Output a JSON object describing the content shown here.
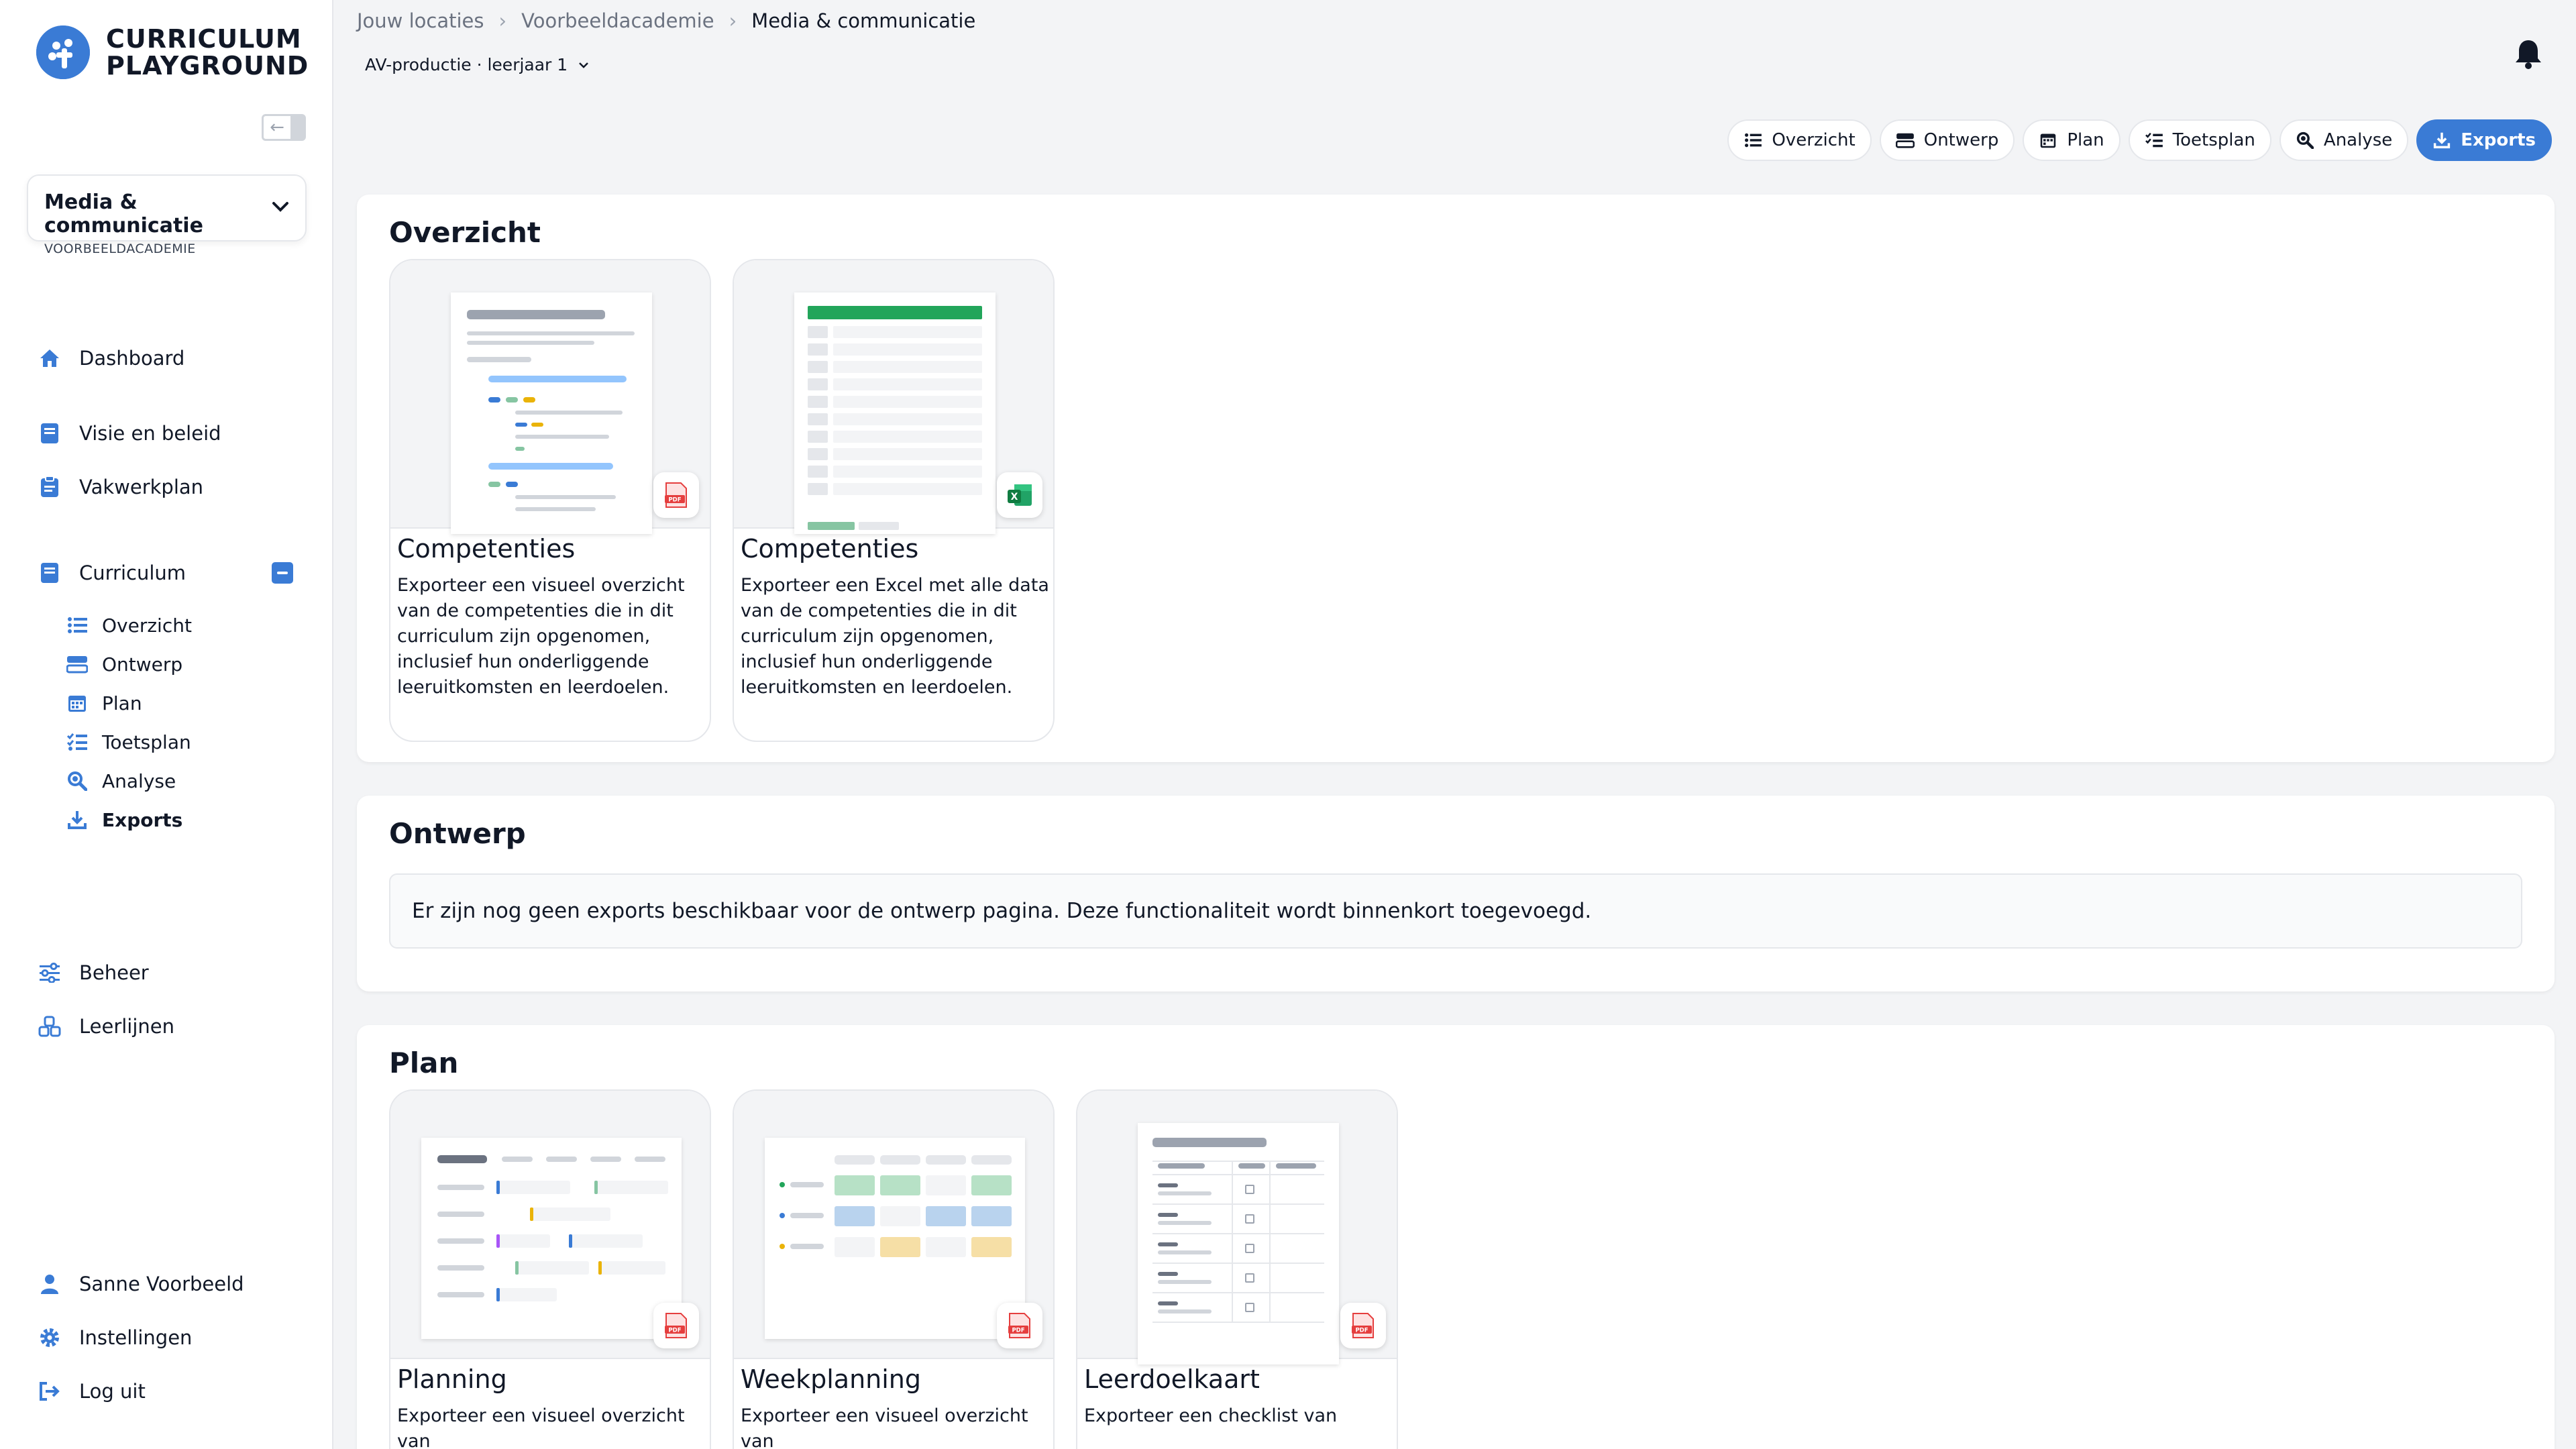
{
  "app": {
    "logo_line1": "CURRICULUM",
    "logo_line2": "PLAYGROUND"
  },
  "location": {
    "title": "Media & communicatie",
    "subtitle": "VOORBEELDACADEMIE"
  },
  "sidebar": {
    "items": [
      {
        "label": "Dashboard",
        "icon": "home-icon"
      },
      {
        "label": "Visie en beleid",
        "icon": "book-icon"
      },
      {
        "label": "Vakwerkplan",
        "icon": "clipboard-icon"
      },
      {
        "label": "Curriculum",
        "icon": "book-icon"
      }
    ],
    "curriculum_sub": [
      {
        "label": "Overzicht",
        "icon": "list-icon"
      },
      {
        "label": "Ontwerp",
        "icon": "design-icon"
      },
      {
        "label": "Plan",
        "icon": "calendar-icon"
      },
      {
        "label": "Toetsplan",
        "icon": "checklist-icon"
      },
      {
        "label": "Analyse",
        "icon": "magnifier-icon"
      },
      {
        "label": "Exports",
        "icon": "download-icon"
      }
    ],
    "lower": [
      {
        "label": "Beheer",
        "icon": "sliders-icon"
      },
      {
        "label": "Leerlijnen",
        "icon": "cubes-icon"
      }
    ],
    "user": {
      "name": "Sanne Voorbeeld",
      "settings": "Instellingen",
      "logout": "Log uit"
    }
  },
  "breadcrumb": [
    "Jouw locaties",
    "Voorbeeldacademie",
    "Media & communicatie"
  ],
  "course_selector": "AV-productie · leerjaar 1",
  "tabs": [
    "Overzicht",
    "Ontwerp",
    "Plan",
    "Toetsplan",
    "Analyse",
    "Exports"
  ],
  "sections": {
    "overzicht": {
      "title": "Overzicht",
      "cards": [
        {
          "title": "Competenties",
          "desc": "Exporteer een visueel overzicht van de competenties die in dit curriculum zijn opgenomen, inclusief hun onderliggende leeruitkomsten en leerdoelen.",
          "format": "PDF"
        },
        {
          "title": "Competenties",
          "desc": "Exporteer een Excel met alle data van de competenties die in dit curriculum zijn opgenomen, inclusief hun onderliggende leeruitkomsten en leerdoelen.",
          "format": "XLS"
        }
      ]
    },
    "ontwerp": {
      "title": "Ontwerp",
      "empty": "Er zijn nog geen exports beschikbaar voor de ontwerp pagina. Deze functionaliteit wordt binnenkort toegevoegd."
    },
    "plan": {
      "title": "Plan",
      "cards": [
        {
          "title": "Planning",
          "desc": "Exporteer een visueel overzicht van",
          "format": "PDF"
        },
        {
          "title": "Weekplanning",
          "desc": "Exporteer een visueel overzicht van",
          "format": "PDF"
        },
        {
          "title": "Leerdoelkaart",
          "desc": "Exporteer een checklist van",
          "format": "PDF"
        }
      ]
    }
  },
  "colors": {
    "accent": "#3a7bd5",
    "pdf": "#e53e3e",
    "excel": "#1e8449"
  }
}
